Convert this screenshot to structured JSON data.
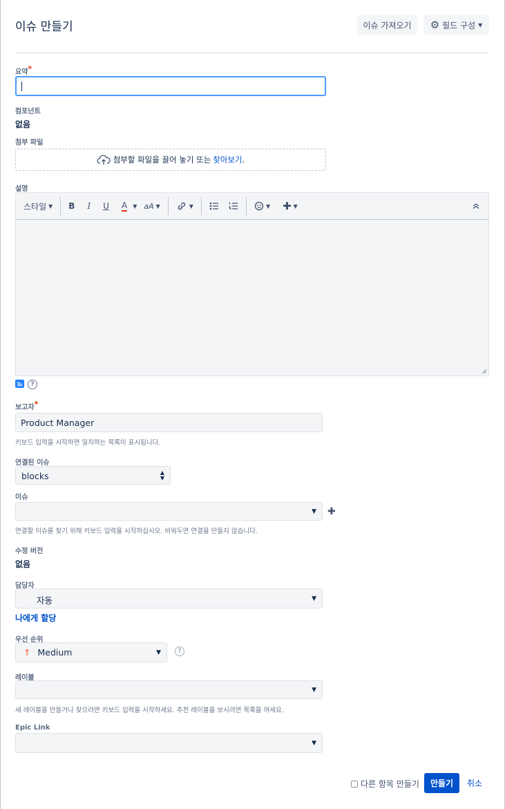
{
  "header": {
    "title": "이슈 만들기",
    "import_label": "이슈 가져오기",
    "configure_label": "필드 구성"
  },
  "summary": {
    "label": "요약",
    "required_mark": "*",
    "value": ""
  },
  "component": {
    "label": "컴포넌트",
    "value": "없음"
  },
  "attachment": {
    "label": "첨부 파일",
    "drop_text": "첨부할 파일을 끌어 놓기 또는",
    "browse_link": "찾아보기",
    "period": "."
  },
  "description": {
    "label": "설명",
    "toolbar": {
      "style": "스타일",
      "bold": "B",
      "italic": "I",
      "underline": "U",
      "text_color": "A",
      "more_format": "aA"
    }
  },
  "reporter": {
    "label": "보고자",
    "required_mark": "*",
    "value": "Product Manager",
    "help": "키보드 입력을 시작하면 일치하는 목록이 표시됩니다."
  },
  "linked_issues": {
    "label": "연결된 이슈",
    "value": "blocks"
  },
  "issue": {
    "label": "이슈",
    "value": "",
    "help": "연결할 이슈를 찾기 위해 키보드 입력을 시작하십시오. 비워두면 연결을 만들지 않습니다."
  },
  "fix_version": {
    "label": "수정 버전",
    "value": "없음"
  },
  "assignee": {
    "label": "담당자",
    "value": "자동",
    "assign_to_me": "나에게 할당"
  },
  "priority": {
    "label": "우선 순위",
    "value": "Medium",
    "color": "#ff7452"
  },
  "labels": {
    "label": "레이블",
    "value": "",
    "help": "새 레이블을 만들거나 찾으려면 키보드 입력을 시작하세요. 추천 레이블을 보시려면 목록을 여세요."
  },
  "epic_link": {
    "label": "Epic Link",
    "value": ""
  },
  "footer": {
    "create_another": "다른 항목 만들기",
    "create": "만들기",
    "cancel": "취소"
  },
  "colors": {
    "primary": "#0052cc",
    "focus": "#4c9aff",
    "required": "#de350b"
  }
}
